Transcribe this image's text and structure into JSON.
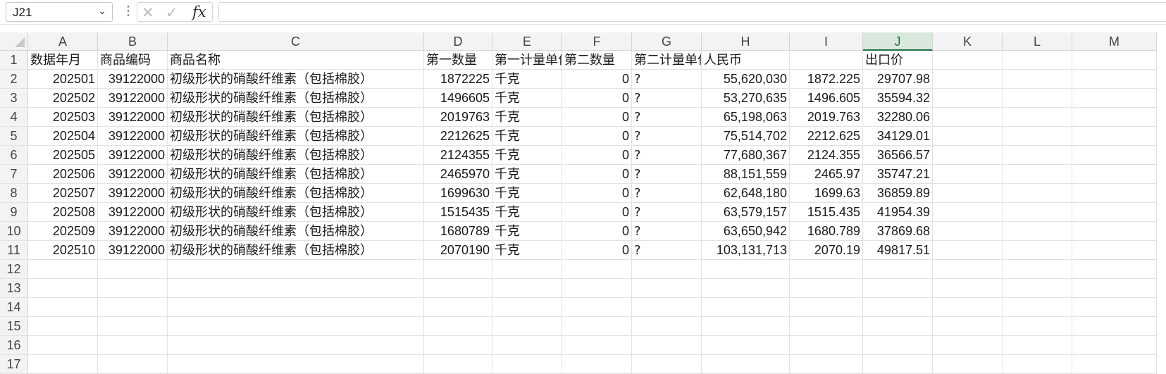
{
  "formula_bar": {
    "name_box": "J21",
    "fx_label": "fx",
    "cancel_icon": "✕",
    "enter_icon": "✓",
    "formula": ""
  },
  "columns": [
    "A",
    "B",
    "C",
    "D",
    "E",
    "F",
    "G",
    "H",
    "I",
    "J",
    "K",
    "L",
    "M"
  ],
  "selected_column": "J",
  "row_numbers": [
    "1",
    "2",
    "3",
    "4",
    "5",
    "6",
    "7",
    "8",
    "9",
    "10",
    "11",
    "12",
    "13",
    "14",
    "15",
    "16",
    "17"
  ],
  "headers": [
    "数据年月",
    "商品编码",
    "商品名称",
    "第一数量",
    "第一计量单位",
    "第二数量",
    "第二计量单位",
    "人民币",
    "",
    "出口价"
  ],
  "rows": [
    [
      "202501",
      "39122000",
      "初级形状的硝酸纤维素（包括棉胶）",
      "1872225",
      "千克",
      "0",
      "?",
      "55,620,030",
      "1872.225",
      "29707.98"
    ],
    [
      "202502",
      "39122000",
      "初级形状的硝酸纤维素（包括棉胶）",
      "1496605",
      "千克",
      "0",
      "?",
      "53,270,635",
      "1496.605",
      "35594.32"
    ],
    [
      "202503",
      "39122000",
      "初级形状的硝酸纤维素（包括棉胶）",
      "2019763",
      "千克",
      "0",
      "?",
      "65,198,063",
      "2019.763",
      "32280.06"
    ],
    [
      "202504",
      "39122000",
      "初级形状的硝酸纤维素（包括棉胶）",
      "2212625",
      "千克",
      "0",
      "?",
      "75,514,702",
      "2212.625",
      "34129.01"
    ],
    [
      "202505",
      "39122000",
      "初级形状的硝酸纤维素（包括棉胶）",
      "2124355",
      "千克",
      "0",
      "?",
      "77,680,367",
      "2124.355",
      "36566.57"
    ],
    [
      "202506",
      "39122000",
      "初级形状的硝酸纤维素（包括棉胶）",
      "2465970",
      "千克",
      "0",
      "?",
      "88,151,559",
      "2465.97",
      "35747.21"
    ],
    [
      "202507",
      "39122000",
      "初级形状的硝酸纤维素（包括棉胶）",
      "1699630",
      "千克",
      "0",
      "?",
      "62,648,180",
      "1699.63",
      "36859.89"
    ],
    [
      "202508",
      "39122000",
      "初级形状的硝酸纤维素（包括棉胶）",
      "1515435",
      "千克",
      "0",
      "?",
      "63,579,157",
      "1515.435",
      "41954.39"
    ],
    [
      "202509",
      "39122000",
      "初级形状的硝酸纤维素（包括棉胶）",
      "1680789",
      "千克",
      "0",
      "?",
      "63,650,942",
      "1680.789",
      "37869.68"
    ],
    [
      "202510",
      "39122000",
      "初级形状的硝酸纤维素（包括棉胶）",
      "2070190",
      "千克",
      "0",
      "?",
      "103,131,713",
      "2070.19",
      "49817.51"
    ]
  ]
}
